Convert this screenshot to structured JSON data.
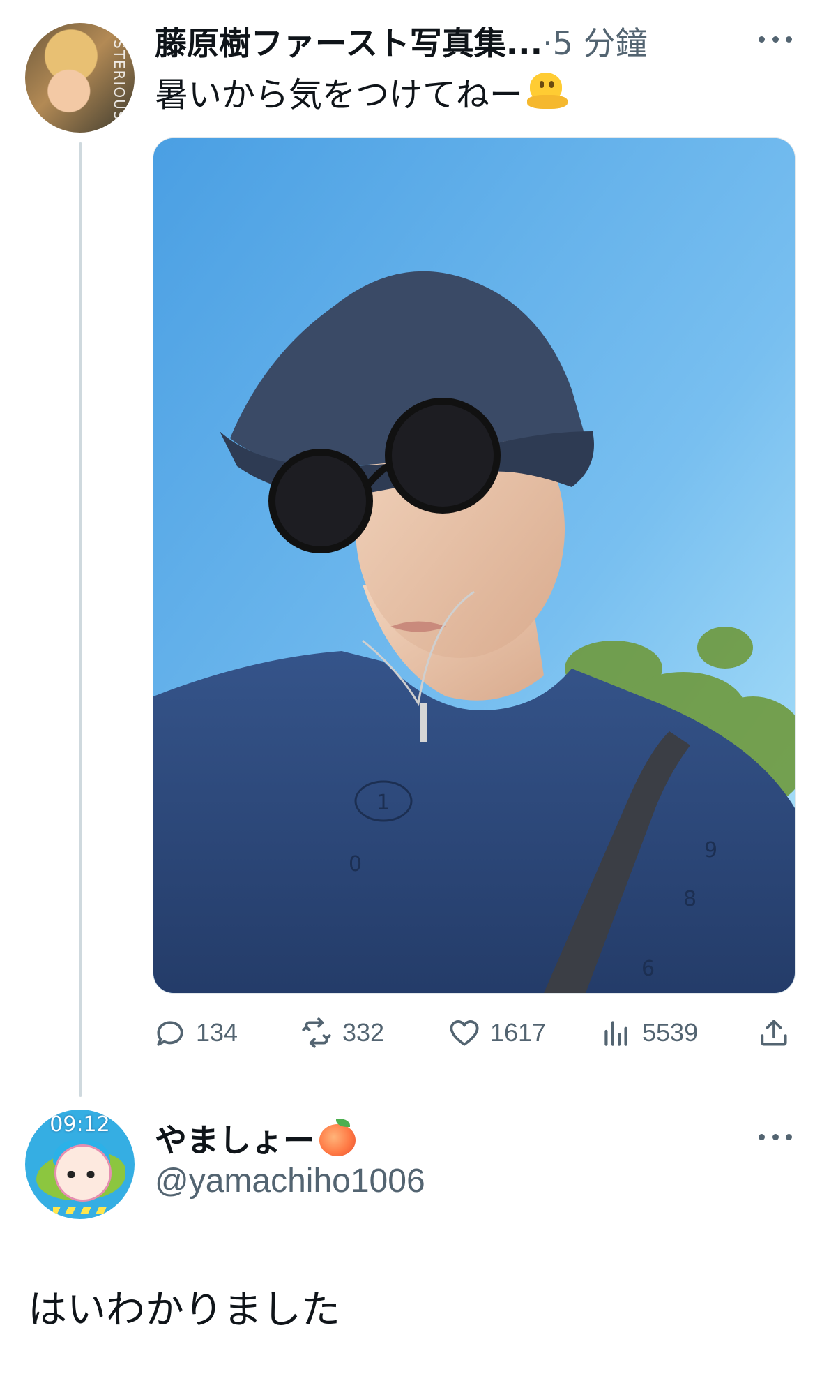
{
  "tweet": {
    "author_name": "藤原樹ファースト写真集...",
    "separator": "·",
    "time": "5 分鐘",
    "text": "暑いから気をつけてねー",
    "emoji": "melting-face-emoji",
    "avatar_text": "STERIOUS",
    "actions": {
      "replies": "134",
      "retweets": "332",
      "likes": "1617",
      "views": "5539"
    }
  },
  "reply": {
    "author_name": "やましょー",
    "emoji": "peach-emoji",
    "handle": "@yamachiho1006",
    "avatar_clock": "09:12",
    "text": "はいわかりました"
  },
  "colors": {
    "text_primary": "#0f1419",
    "text_secondary": "#536471",
    "thread_line": "#cfd9de",
    "sky": "#6fb9ee",
    "shirt": "#2f4a7a"
  }
}
